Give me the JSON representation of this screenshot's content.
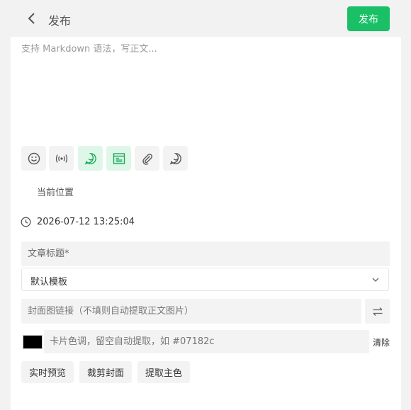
{
  "header": {
    "title": "发布",
    "publish_label": "发布",
    "back_icon": "chevron-left-icon"
  },
  "editor": {
    "placeholder": "支持 Markdown 语法，写正文...",
    "value": ""
  },
  "toolbar": {
    "items": [
      {
        "icon": "emoji-icon",
        "active": false
      },
      {
        "icon": "broadcast-icon",
        "active": false
      },
      {
        "icon": "whatsapp-chat-icon",
        "active": true
      },
      {
        "icon": "article-template-icon",
        "active": true
      },
      {
        "icon": "paperclip-icon",
        "active": false
      },
      {
        "icon": "chat-bubble-icon",
        "active": false
      }
    ]
  },
  "location": {
    "label": "当前位置"
  },
  "datetime": {
    "value": "2026-07-12 13:25:04",
    "icon": "clock-icon"
  },
  "article_title": {
    "placeholder": "文章标题*",
    "value": ""
  },
  "template": {
    "selected": "默认模板"
  },
  "cover": {
    "placeholder": "封面图链接（不填则自动提取正文图片）",
    "value": ""
  },
  "card_color": {
    "swatch": "#000000",
    "placeholder": "卡片色调，留空自动提取，如 #07182c",
    "value": "",
    "clear_label": "清除"
  },
  "actions": {
    "preview_label": "实时预览",
    "crop_label": "裁剪封面",
    "extract_label": "提取主色"
  },
  "colors": {
    "accent": "#19c066",
    "active_tool_bg": "#dff7e8"
  }
}
